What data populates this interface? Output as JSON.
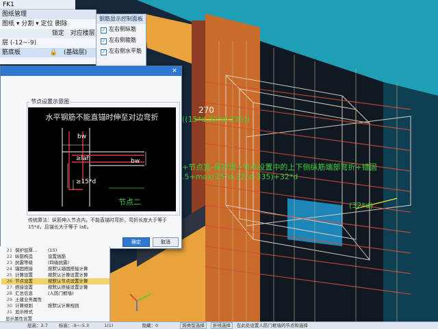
{
  "window": {
    "tab_title": "FK1"
  },
  "toolbar": {
    "tab_drawing_mgmt": "图纸管理",
    "row2": "图纸 ▾  分割 ▾  定位  删除",
    "col_lock": "锁定",
    "col_floor": "对应楼层",
    "row3": "层 (-12~-9)",
    "row4": "筋底板",
    "row4_value": "(基础层)"
  },
  "control_panel": {
    "title": "钢筋显示控制面板",
    "items": [
      "左右侧纵筋",
      "左右侧箍筋",
      "左右侧水平筋"
    ]
  },
  "dialog": {
    "group_label": "节点设置示意图",
    "diagram_title": "水平钢筋不能直锚时伸至对边弯折",
    "labels": {
      "bw_top": "bw",
      "laf": "≥laf",
      "bw_right": "bw",
      "fifteen_d": "≥15*d",
      "node": "节点二"
    },
    "description": "传统算法：纵筋伸入节点内，不能直锚时弯折，弯折长度大于等于 15*d，且锚长大于等于 laE。",
    "ok_label": "确定",
    "cancel_label": "取消"
  },
  "properties": {
    "rows": [
      {
        "n": "21",
        "k": "保护层厚...",
        "v": "(15)"
      },
      {
        "n": "22",
        "k": "纵筋构造",
        "v": "设置插筋"
      },
      {
        "n": "23",
        "k": "抗震等级",
        "v": "(四级抗震)"
      },
      {
        "n": "24",
        "k": "锚固搭接",
        "v": "按默认锚固搭接计算"
      },
      {
        "n": "25",
        "k": "计算设置",
        "v": "按默认计算设置计算"
      },
      {
        "n": "26",
        "k": "节点设置",
        "v": "按默认节点设置计算"
      },
      {
        "n": "27",
        "k": "搭接设置",
        "v": "按默认搭接设置计算"
      },
      {
        "n": "28",
        "k": "汇总信息",
        "v": "(人防门框墙)"
      },
      {
        "n": "29",
        "k": "土建业务属性",
        "v": ""
      },
      {
        "n": "30",
        "k": "计算规则",
        "v": "按默认计算规则"
      },
      {
        "n": "31",
        "k": "显示样式",
        "v": ""
      }
    ],
    "footer": "显示属性设置"
  },
  "canvas": {
    "dim_270": "270",
    "formula1": "((15*d,32*d-335))",
    "formula2": "+节点宽-保护层+节点设置中的上下侧纵筋端部弯折+错固",
    "formula3": ".5+max(15*d,32*d-335)+32*d",
    "formula4": "(32*d)"
  },
  "status_bar": {
    "items": [
      "层高：3.7",
      "标高：-9~-5.3",
      "1(1)",
      "隐藏：0",
      "跨类型选择",
      "折线选择",
      "在此处设置人防门框墙的节点和选择"
    ]
  },
  "colors": {
    "concrete_orange": "#d97a2c",
    "rebar_red": "#c23a34",
    "formula_green": "#3bd13b",
    "dim_yellow": "#e8e83a",
    "cyan_face": "#1e9fb6"
  }
}
